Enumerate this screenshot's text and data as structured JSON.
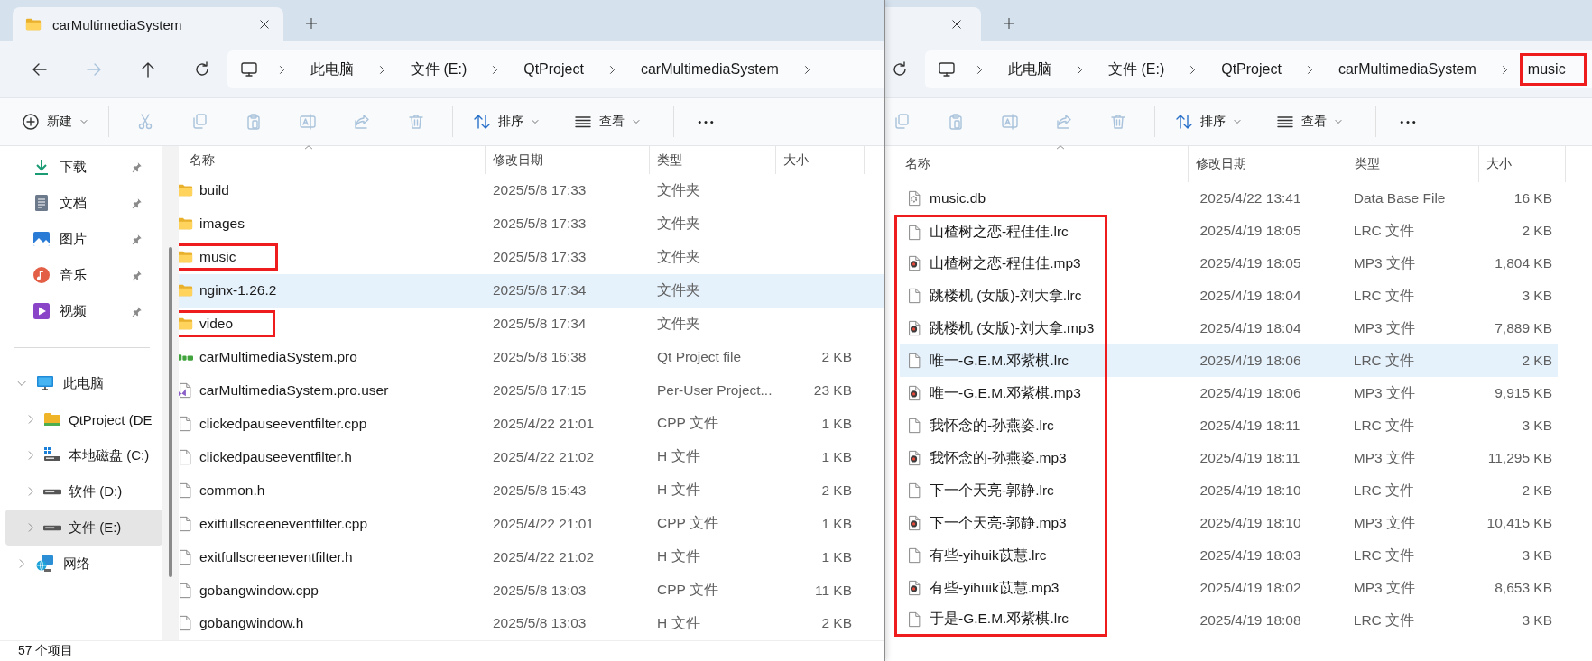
{
  "left_window": {
    "tab": {
      "title": "carMultimediaSystem"
    },
    "nav": [
      {
        "kind": "back",
        "disabled": false
      },
      {
        "kind": "forward",
        "disabled": true
      },
      {
        "kind": "up",
        "disabled": false
      },
      {
        "kind": "refresh",
        "disabled": false
      }
    ],
    "breadcrumb": {
      "items": [
        {
          "label": "此电脑",
          "highlighted": false
        },
        {
          "label": "文件 (E:)",
          "highlighted": false
        },
        {
          "label": "QtProject",
          "highlighted": false
        },
        {
          "label": "carMultimediaSystem",
          "highlighted": false
        }
      ],
      "trailing_chevron": true
    },
    "toolbar": {
      "new_label": "新建",
      "actions": [
        {
          "kind": "cut",
          "disabled": true
        },
        {
          "kind": "copy",
          "disabled": true
        },
        {
          "kind": "paste",
          "disabled": true
        },
        {
          "kind": "rename",
          "disabled": true
        },
        {
          "kind": "share",
          "disabled": true
        },
        {
          "kind": "delete",
          "disabled": true
        }
      ],
      "sort_label": "排序",
      "view_label": "查看"
    },
    "sidebar": {
      "quick_access": [
        {
          "label": "下载",
          "kind": "download",
          "pinned": true
        },
        {
          "label": "文档",
          "kind": "documents",
          "pinned": true
        },
        {
          "label": "图片",
          "kind": "pictures",
          "pinned": true
        },
        {
          "label": "音乐",
          "kind": "music",
          "pinned": true
        },
        {
          "label": "视频",
          "kind": "videos",
          "pinned": true
        }
      ],
      "tree": [
        {
          "label": "此电脑",
          "kind": "pc",
          "expanded": true,
          "selected": false,
          "children": [
            {
              "label": "QtProject (DE",
              "kind": "folder-drive",
              "expanded": false,
              "selected": false
            },
            {
              "label": "本地磁盘 (C:)",
              "kind": "system-drive",
              "expanded": false,
              "selected": false
            },
            {
              "label": "软件 (D:)",
              "kind": "drive",
              "expanded": false,
              "selected": false
            },
            {
              "label": "文件 (E:)",
              "kind": "drive",
              "expanded": false,
              "selected": true
            }
          ]
        },
        {
          "label": "网络",
          "kind": "network",
          "expanded": false,
          "selected": false
        }
      ]
    },
    "columns": [
      "名称",
      "修改日期",
      "类型",
      "大小"
    ],
    "rows": [
      {
        "name": "build",
        "date": "2025/5/8 17:33",
        "type": "文件夹",
        "kind": "folder",
        "highlighted": false,
        "hovered": false
      },
      {
        "name": "images",
        "date": "2025/5/8 17:33",
        "type": "文件夹",
        "kind": "folder",
        "highlighted": false,
        "hovered": false
      },
      {
        "name": "music",
        "date": "2025/5/8 17:33",
        "type": "文件夹",
        "kind": "folder",
        "highlighted": true,
        "hovered": false
      },
      {
        "name": "nginx-1.26.2",
        "date": "2025/5/8 17:34",
        "type": "文件夹",
        "kind": "folder",
        "highlighted": false,
        "hovered": true
      },
      {
        "name": "video",
        "date": "2025/5/8 17:34",
        "type": "文件夹",
        "kind": "folder",
        "highlighted": true,
        "hovered": false
      },
      {
        "name": "carMultimediaSystem.pro",
        "date": "2025/5/8 16:38",
        "type": "Qt Project file",
        "size": "2 KB",
        "kind": "pro",
        "highlighted": false,
        "hovered": false
      },
      {
        "name": "carMultimediaSystem.pro.user",
        "date": "2025/5/8 17:15",
        "type": "Per-User Project...",
        "size": "23 KB",
        "kind": "user",
        "highlighted": false,
        "hovered": false
      },
      {
        "name": "clickedpauseeventfilter.cpp",
        "date": "2025/4/22 21:01",
        "type": "CPP 文件",
        "size": "1 KB",
        "kind": "file",
        "highlighted": false,
        "hovered": false
      },
      {
        "name": "clickedpauseeventfilter.h",
        "date": "2025/4/22 21:02",
        "type": "H 文件",
        "size": "1 KB",
        "kind": "file",
        "highlighted": false,
        "hovered": false
      },
      {
        "name": "common.h",
        "date": "2025/5/8 15:43",
        "type": "H 文件",
        "size": "2 KB",
        "kind": "file",
        "highlighted": false,
        "hovered": false
      },
      {
        "name": "exitfullscreeneventfilter.cpp",
        "date": "2025/4/22 21:01",
        "type": "CPP 文件",
        "size": "1 KB",
        "kind": "file",
        "highlighted": false,
        "hovered": false
      },
      {
        "name": "exitfullscreeneventfilter.h",
        "date": "2025/4/22 21:02",
        "type": "H 文件",
        "size": "1 KB",
        "kind": "file",
        "highlighted": false,
        "hovered": false
      },
      {
        "name": "gobangwindow.cpp",
        "date": "2025/5/8 13:03",
        "type": "CPP 文件",
        "size": "11 KB",
        "kind": "file",
        "highlighted": false,
        "hovered": false
      },
      {
        "name": "gobangwindow.h",
        "date": "2025/5/8 13:03",
        "type": "H 文件",
        "size": "2 KB",
        "kind": "file",
        "highlighted": false,
        "hovered": false
      }
    ],
    "status": "57 个项目"
  },
  "right_window": {
    "breadcrumb": {
      "items": [
        {
          "label": "此电脑",
          "highlighted": false
        },
        {
          "label": "文件 (E:)",
          "highlighted": false
        },
        {
          "label": "QtProject",
          "highlighted": false
        },
        {
          "label": "carMultimediaSystem",
          "highlighted": false
        },
        {
          "label": "music",
          "highlighted": true
        }
      ]
    },
    "toolbar": {
      "actions": [
        {
          "kind": "copy",
          "disabled": true
        },
        {
          "kind": "paste",
          "disabled": true
        },
        {
          "kind": "rename",
          "disabled": true
        },
        {
          "kind": "share",
          "disabled": true
        },
        {
          "kind": "delete",
          "disabled": true
        }
      ],
      "sort_label": "排序",
      "view_label": "查看"
    },
    "columns": [
      "名称",
      "修改日期",
      "类型",
      "大小"
    ],
    "rows": [
      {
        "name": "music.db",
        "date": "2025/4/22 13:41",
        "type": "Data Base File",
        "size": "16 KB",
        "kind": "db",
        "highlighted": false,
        "hovered": false
      },
      {
        "name": "山楂树之恋-程佳佳.lrc",
        "date": "2025/4/19 18:05",
        "type": "LRC 文件",
        "size": "2 KB",
        "kind": "file",
        "highlighted": true,
        "hovered": false
      },
      {
        "name": "山楂树之恋-程佳佳.mp3",
        "date": "2025/4/19 18:05",
        "type": "MP3 文件",
        "size": "1,804 KB",
        "kind": "mp3",
        "highlighted": true,
        "hovered": false
      },
      {
        "name": "跳楼机 (女版)-刘大拿.lrc",
        "date": "2025/4/19 18:04",
        "type": "LRC 文件",
        "size": "3 KB",
        "kind": "file",
        "highlighted": true,
        "hovered": false
      },
      {
        "name": "跳楼机 (女版)-刘大拿.mp3",
        "date": "2025/4/19 18:04",
        "type": "MP3 文件",
        "size": "7,889 KB",
        "kind": "mp3",
        "highlighted": true,
        "hovered": false
      },
      {
        "name": "唯一-G.E.M.邓紫棋.lrc",
        "date": "2025/4/19 18:06",
        "type": "LRC 文件",
        "size": "2 KB",
        "kind": "file",
        "highlighted": true,
        "hovered": true
      },
      {
        "name": "唯一-G.E.M.邓紫棋.mp3",
        "date": "2025/4/19 18:06",
        "type": "MP3 文件",
        "size": "9,915 KB",
        "kind": "mp3",
        "highlighted": true,
        "hovered": false
      },
      {
        "name": "我怀念的-孙燕姿.lrc",
        "date": "2025/4/19 18:11",
        "type": "LRC 文件",
        "size": "3 KB",
        "kind": "file",
        "highlighted": true,
        "hovered": false
      },
      {
        "name": "我怀念的-孙燕姿.mp3",
        "date": "2025/4/19 18:11",
        "type": "MP3 文件",
        "size": "11,295 KB",
        "kind": "mp3",
        "highlighted": true,
        "hovered": false
      },
      {
        "name": "下一个天亮-郭静.lrc",
        "date": "2025/4/19 18:10",
        "type": "LRC 文件",
        "size": "2 KB",
        "kind": "file",
        "highlighted": true,
        "hovered": false
      },
      {
        "name": "下一个天亮-郭静.mp3",
        "date": "2025/4/19 18:10",
        "type": "MP3 文件",
        "size": "10,415 KB",
        "kind": "mp3",
        "highlighted": true,
        "hovered": false
      },
      {
        "name": "有些-yihuik苡慧.lrc",
        "date": "2025/4/19 18:03",
        "type": "LRC 文件",
        "size": "3 KB",
        "kind": "file",
        "highlighted": true,
        "hovered": false
      },
      {
        "name": "有些-yihuik苡慧.mp3",
        "date": "2025/4/19 18:02",
        "type": "MP3 文件",
        "size": "8,653 KB",
        "kind": "mp3",
        "highlighted": true,
        "hovered": false
      },
      {
        "name": "于是-G.E.M.邓紫棋.lrc",
        "date": "2025/4/19 18:08",
        "type": "LRC 文件",
        "size": "3 KB",
        "kind": "file",
        "highlighted": true,
        "hovered": false
      }
    ]
  }
}
